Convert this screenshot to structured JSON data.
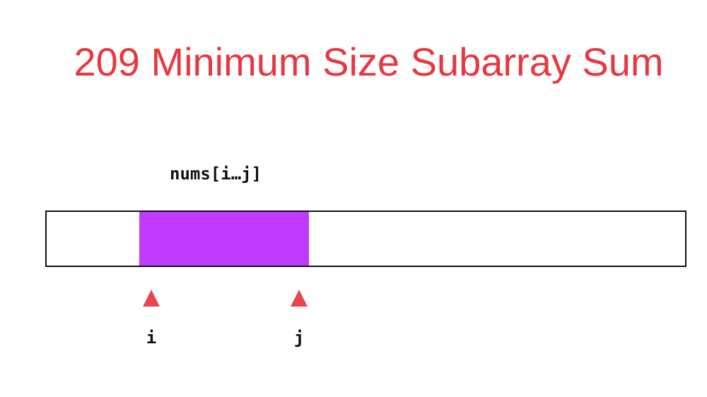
{
  "title": "209 Minimum Size Subarray Sum",
  "range_label": "nums[i…j]",
  "pointers": {
    "i": {
      "label": "i",
      "icon": "triangle-up-icon"
    },
    "j": {
      "label": "j",
      "icon": "triangle-up-icon"
    }
  },
  "colors": {
    "title": "#e8383f",
    "subarray": "#c03bff",
    "marker": "#e8474f",
    "outline": "#111111"
  }
}
